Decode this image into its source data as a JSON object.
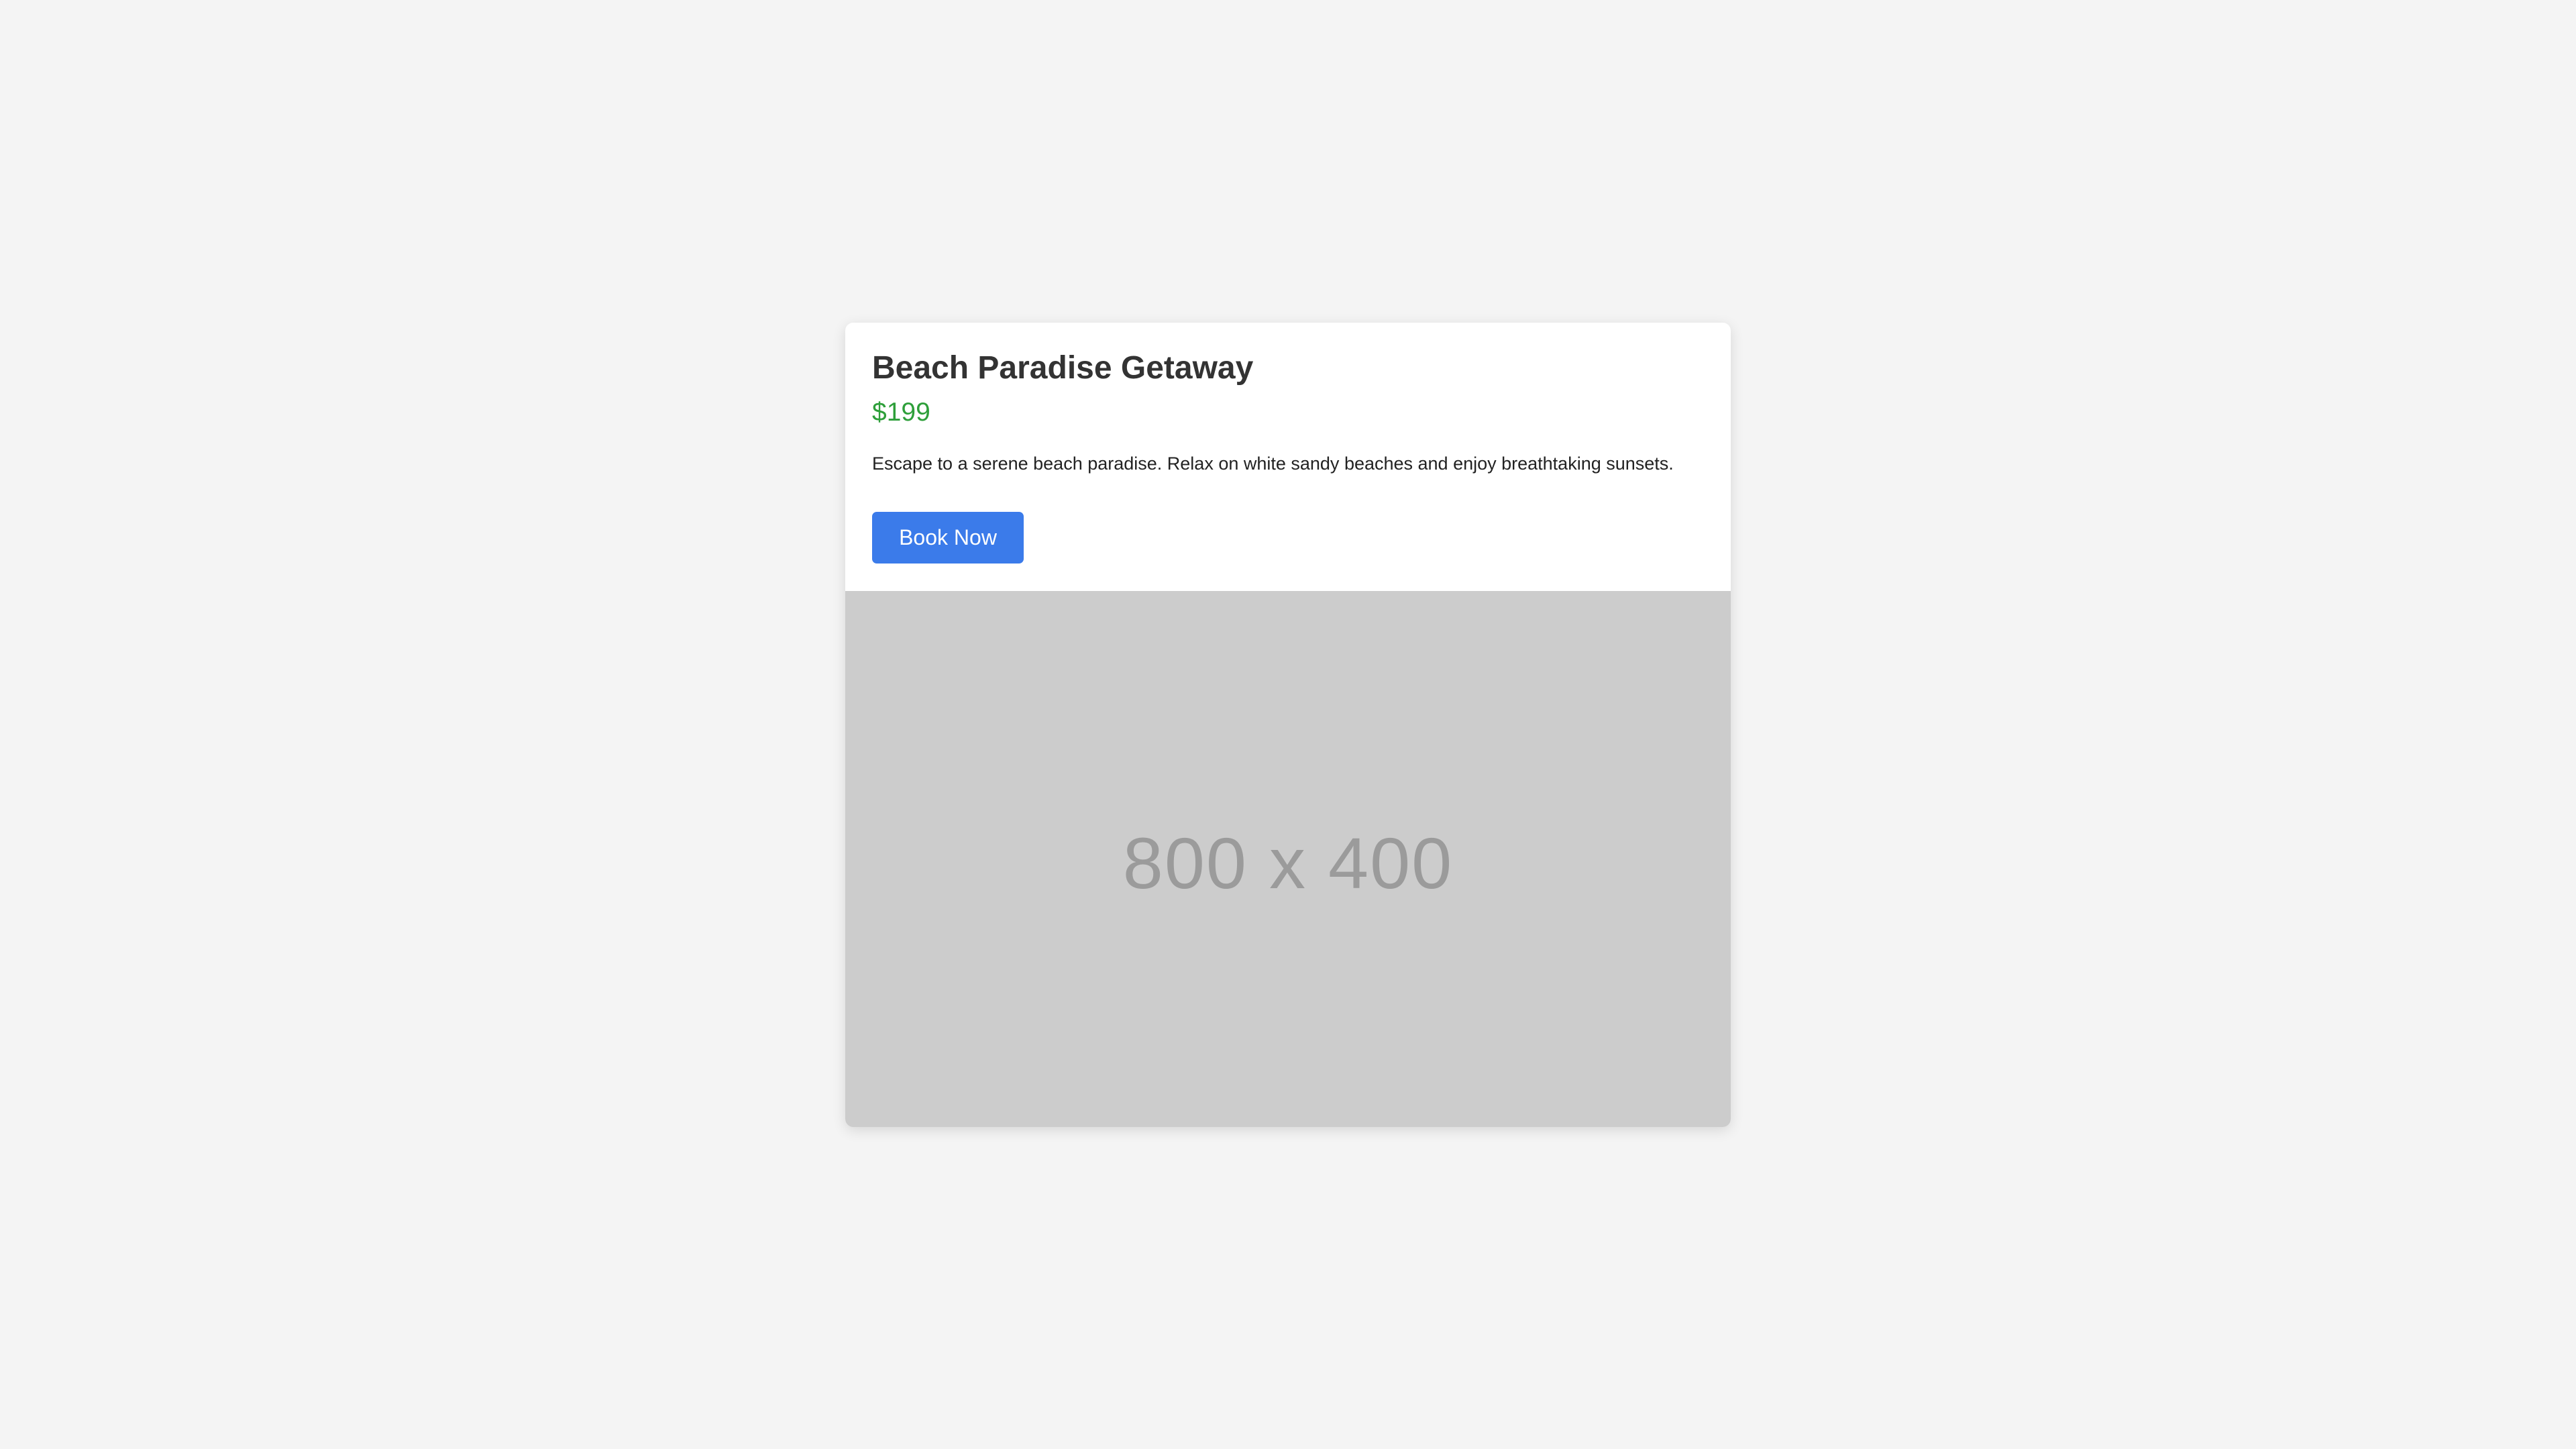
{
  "card": {
    "title": "Beach Paradise Getaway",
    "price": "$199",
    "description": "Escape to a serene beach paradise. Relax on white sandy beaches and enjoy breathtaking sunsets.",
    "button_label": "Book Now",
    "image_placeholder": "800 x 400"
  },
  "colors": {
    "page_background": "#f4f4f4",
    "card_background": "#ffffff",
    "title": "#333333",
    "price": "#2e9f3a",
    "button": "#3b7bea",
    "image_placeholder_background": "#cccccc",
    "image_placeholder_text": "#9b9b9b"
  }
}
